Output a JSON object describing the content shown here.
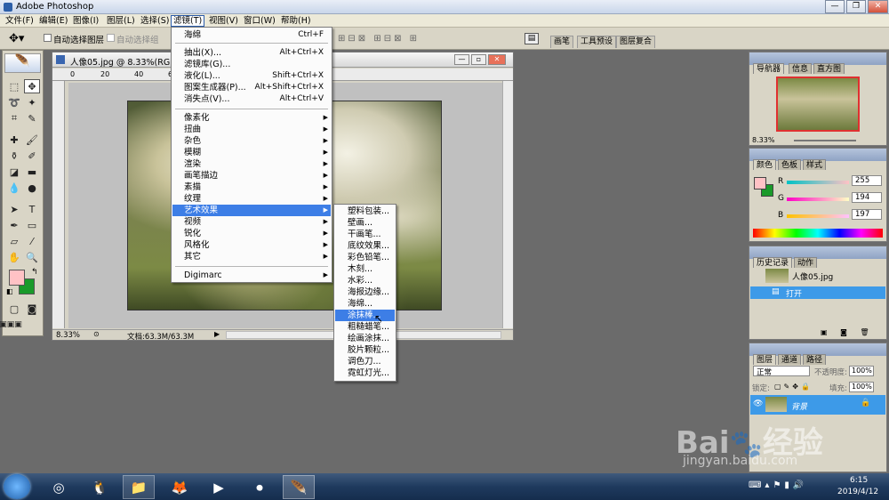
{
  "app": {
    "title": "Adobe Photoshop",
    "controls": [
      "—",
      "❐",
      "✕"
    ]
  },
  "menubar": [
    "文件(F)",
    "编辑(E)",
    "图像(I)",
    "图层(L)",
    "选择(S)",
    "滤镜(T)",
    "视图(V)",
    "窗口(W)",
    "帮助(H)"
  ],
  "options": {
    "auto_select_layer": "自动选择图层",
    "auto_select_group": "自动选择组",
    "tabs": [
      "画笔",
      "工具预设",
      "图层复合"
    ]
  },
  "document": {
    "title": "人像05.jpg @ 8.33%(RGB/8",
    "zoom": "8.33%",
    "file_info": "文档:63.3M/63.3M",
    "ruler": [
      "0",
      "20",
      "40",
      "60"
    ]
  },
  "filter_menu": {
    "top": [
      {
        "label": "海绵",
        "shortcut": "Ctrl+F"
      }
    ],
    "group1": [
      {
        "label": "抽出(X)...",
        "shortcut": "Alt+Ctrl+X"
      },
      {
        "label": "滤镜库(G)...",
        "shortcut": ""
      },
      {
        "label": "液化(L)...",
        "shortcut": "Shift+Ctrl+X"
      },
      {
        "label": "图案生成器(P)...",
        "shortcut": "Alt+Shift+Ctrl+X"
      },
      {
        "label": "消失点(V)...",
        "shortcut": "Alt+Ctrl+V"
      }
    ],
    "group2": [
      "像素化",
      "扭曲",
      "杂色",
      "模糊",
      "渲染",
      "画笔描边",
      "素描",
      "纹理",
      "艺术效果",
      "视频",
      "锐化",
      "风格化",
      "其它"
    ],
    "highlighted": "艺术效果",
    "group3": [
      "Digimarc"
    ]
  },
  "art_submenu": {
    "items": [
      "塑料包装...",
      "壁画...",
      "干画笔...",
      "底纹效果...",
      "彩色铅笔...",
      "木刻...",
      "水彩...",
      "海报边缘...",
      "海绵...",
      "涂抹棒...",
      "粗糙蜡笔...",
      "绘画涂抹...",
      "胶片颗粒...",
      "调色刀...",
      "霓虹灯光..."
    ],
    "highlighted": "涂抹棒..."
  },
  "navigator": {
    "tabs": [
      "导航器",
      "信息",
      "直方图"
    ],
    "zoom": "8.33%"
  },
  "color": {
    "tabs": [
      "颜色",
      "色板",
      "样式"
    ],
    "channels": [
      {
        "label": "R",
        "value": "255"
      },
      {
        "label": "G",
        "value": "194"
      },
      {
        "label": "B",
        "value": "197"
      }
    ],
    "foreground": "#ffc2c5",
    "background": "#1a9a2a"
  },
  "history": {
    "tabs": [
      "历史记录",
      "动作"
    ],
    "snapshot": "人像05.jpg",
    "step": "打开"
  },
  "layers": {
    "tabs": [
      "图层",
      "通道",
      "路径"
    ],
    "mode": "正常",
    "opacity_label": "不透明度:",
    "opacity": "100%",
    "lock_label": "锁定:",
    "fill_label": "填充:",
    "fill": "100%",
    "layer_name": "背景"
  },
  "watermark": {
    "brand": "Bai",
    "brand2": "经验",
    "url": "jingyan.baidu.com"
  },
  "taskbar": {
    "time": "6:15",
    "date": "2019/4/12"
  }
}
